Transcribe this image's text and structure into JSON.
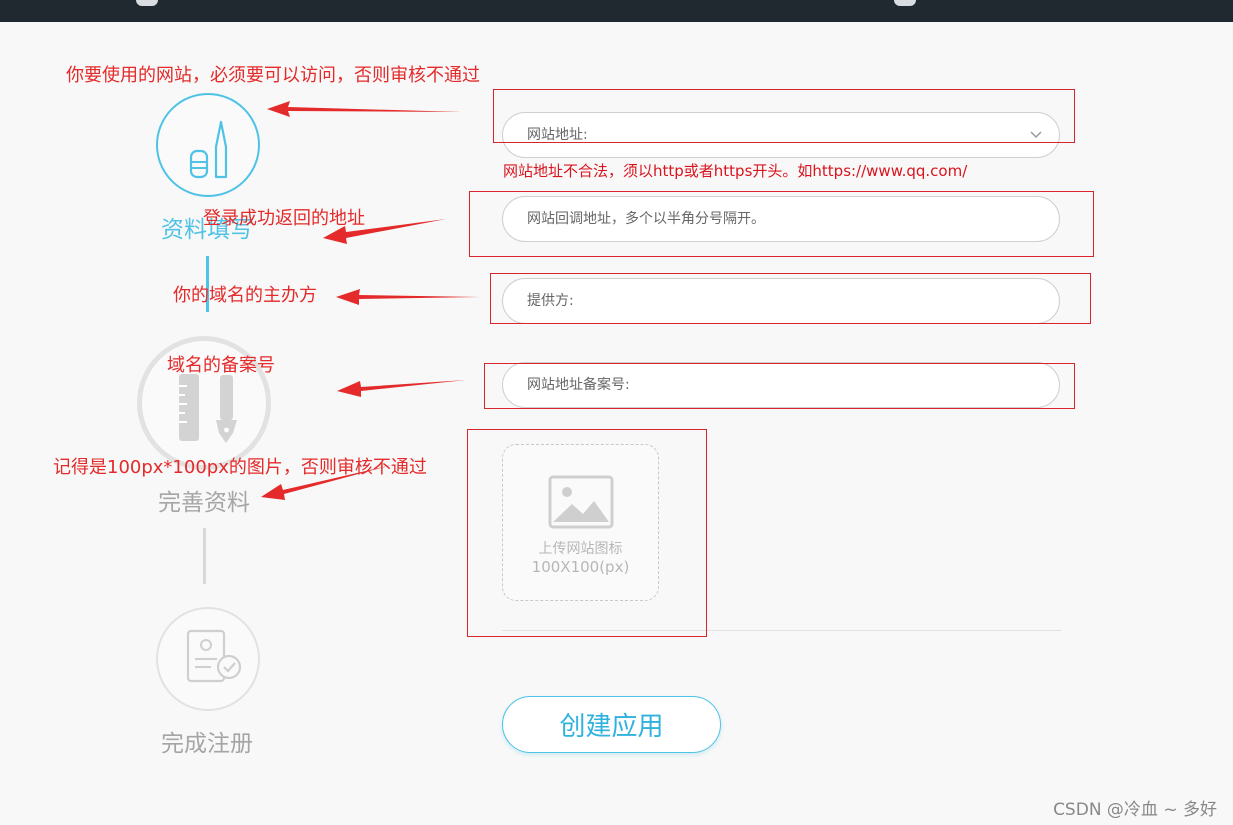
{
  "form": {
    "website_url": {
      "placeholder": "网站地址:"
    },
    "url_error": "网站地址不合法，须以http或者https开头。如https://www.qq.com/",
    "callback_url": {
      "placeholder": "网站回调地址，多个以半角分号隔开。"
    },
    "provider": {
      "placeholder": "提供方:"
    },
    "icp_number": {
      "placeholder": "网站地址备案号:"
    },
    "upload": {
      "line1": "上传网站图标",
      "line2": "100X100(px)"
    },
    "submit_label": "创建应用"
  },
  "steps": [
    {
      "label": "资料填写",
      "state": "active"
    },
    {
      "label": "完善资料",
      "state": "inactive"
    },
    {
      "label": "完成注册",
      "state": "inactive"
    }
  ],
  "annotations": [
    "你要使用的网站，必须要可以访问，否则审核不通过",
    "登录成功返回的地址",
    "你的域名的主办方",
    "域名的备案号",
    "记得是100px*100px的图片，否则审核不通过"
  ],
  "watermark": "CSDN @冷血 ~ 多好",
  "colors": {
    "accent": "#4ec3e6",
    "annotation_red": "#e42a2a",
    "error_red": "#d9141e",
    "inactive_gray": "#d6d6d6",
    "topbar": "#202830"
  }
}
